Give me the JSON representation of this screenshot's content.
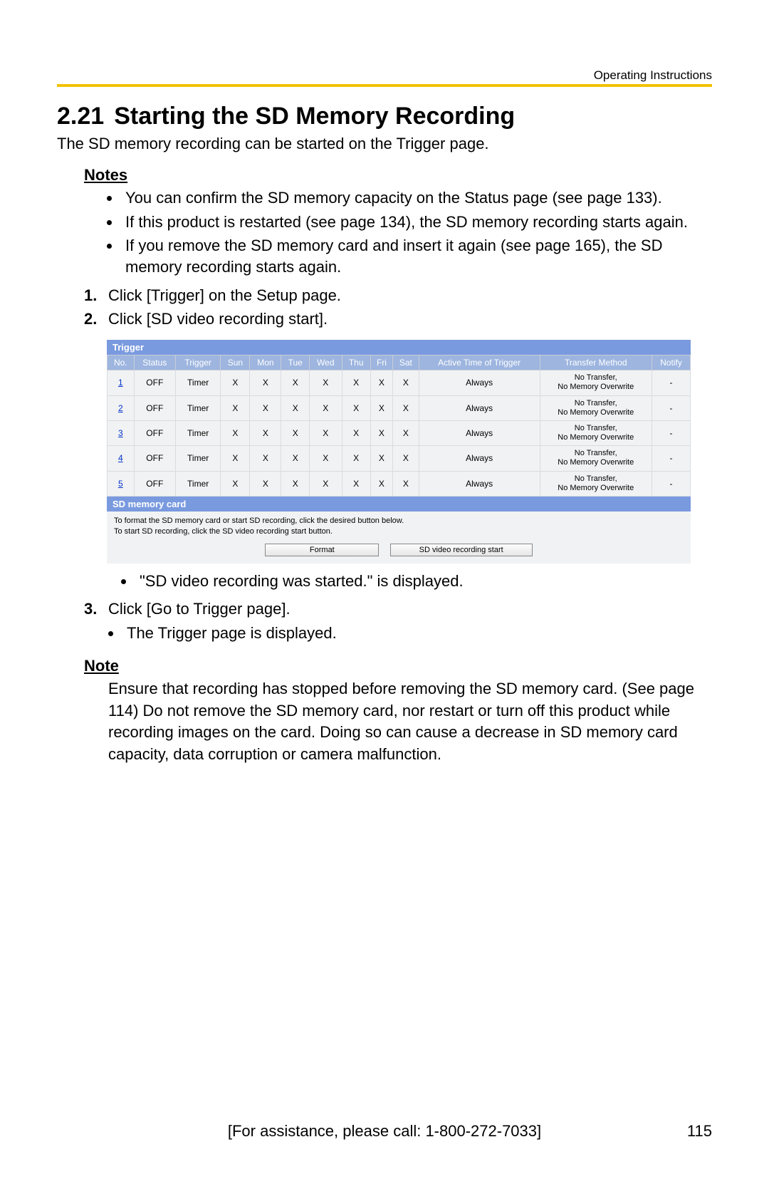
{
  "header": {
    "label": "Operating Instructions"
  },
  "section": {
    "number": "2.21",
    "title": "Starting the SD Memory Recording"
  },
  "intro": "The SD memory recording can be started on the Trigger page.",
  "notes_heading": "Notes",
  "notes": [
    "You can confirm the SD memory capacity on the Status page (see page 133).",
    "If this product is restarted (see page 134), the SD memory recording starts again.",
    "If you remove the SD memory card and insert it again (see page 165), the SD memory recording starts again."
  ],
  "steps": {
    "s1": "Click [Trigger] on the Setup page.",
    "s2": "Click [SD video recording start].",
    "s2_sub": "\"SD video recording was started.\" is displayed.",
    "s3": "Click [Go to Trigger page].",
    "s3_sub": "The Trigger page is displayed."
  },
  "embed": {
    "trigger_bar": "Trigger",
    "headers": {
      "no": "No.",
      "status": "Status",
      "trigger": "Trigger",
      "sun": "Sun",
      "mon": "Mon",
      "tue": "Tue",
      "wed": "Wed",
      "thu": "Thu",
      "fri": "Fri",
      "sat": "Sat",
      "active": "Active Time of Trigger",
      "transfer": "Transfer Method",
      "notify": "Notify"
    },
    "rows": [
      {
        "no": "1",
        "status": "OFF",
        "trigger": "Timer",
        "d": [
          "X",
          "X",
          "X",
          "X",
          "X",
          "X",
          "X"
        ],
        "active": "Always",
        "transfer": "No Transfer, No Memory Overwrite",
        "notify": "-"
      },
      {
        "no": "2",
        "status": "OFF",
        "trigger": "Timer",
        "d": [
          "X",
          "X",
          "X",
          "X",
          "X",
          "X",
          "X"
        ],
        "active": "Always",
        "transfer": "No Transfer, No Memory Overwrite",
        "notify": "-"
      },
      {
        "no": "3",
        "status": "OFF",
        "trigger": "Timer",
        "d": [
          "X",
          "X",
          "X",
          "X",
          "X",
          "X",
          "X"
        ],
        "active": "Always",
        "transfer": "No Transfer, No Memory Overwrite",
        "notify": "-"
      },
      {
        "no": "4",
        "status": "OFF",
        "trigger": "Timer",
        "d": [
          "X",
          "X",
          "X",
          "X",
          "X",
          "X",
          "X"
        ],
        "active": "Always",
        "transfer": "No Transfer, No Memory Overwrite",
        "notify": "-"
      },
      {
        "no": "5",
        "status": "OFF",
        "trigger": "Timer",
        "d": [
          "X",
          "X",
          "X",
          "X",
          "X",
          "X",
          "X"
        ],
        "active": "Always",
        "transfer": "No Transfer, No Memory Overwrite",
        "notify": "-"
      }
    ],
    "sd_bar": "SD memory card",
    "sd_line1": "To format the SD memory card or start SD recording, click the desired button below.",
    "sd_line2": "To start SD recording, click the SD video recording start button.",
    "btn_format": "Format",
    "btn_start": "SD video recording start"
  },
  "note2_heading": "Note",
  "note2_body": "Ensure that recording has stopped before removing the SD memory card. (See page 114) Do not remove the SD memory card, nor restart or turn off this product while recording images on the card. Doing so can cause a decrease in SD memory card capacity, data corruption or camera malfunction.",
  "footer": {
    "assist": "[For assistance, please call: 1-800-272-7033]",
    "page": "115"
  }
}
